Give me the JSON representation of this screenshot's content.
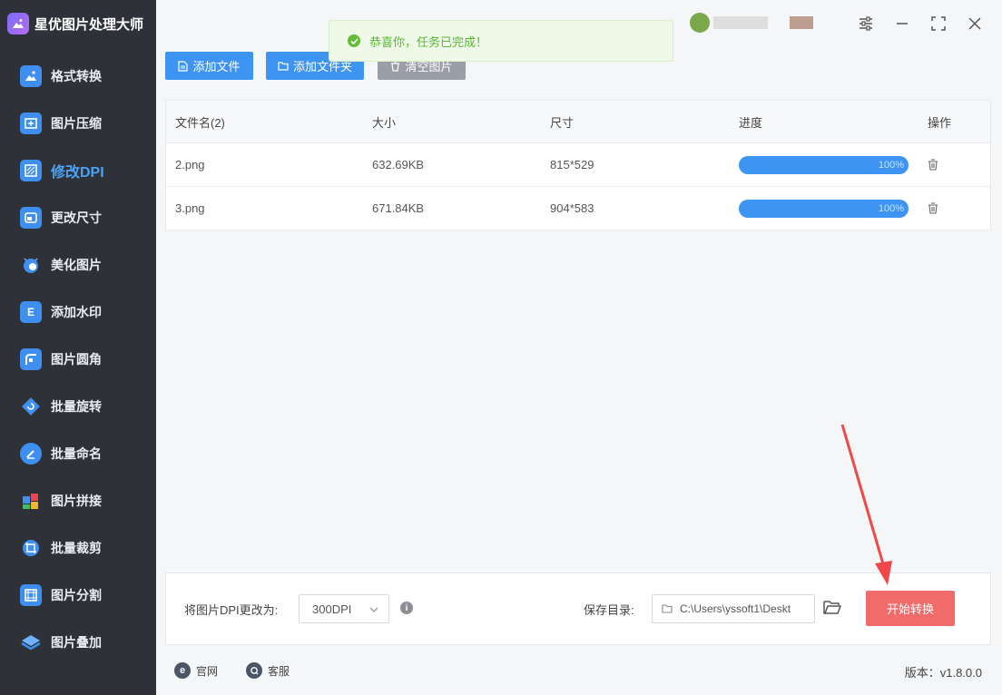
{
  "app": {
    "title": "星优图片处理大师"
  },
  "sidebar": {
    "items": [
      {
        "label": "格式转换",
        "icon": "image-convert-icon"
      },
      {
        "label": "图片压缩",
        "icon": "compress-icon"
      },
      {
        "label": "修改DPI",
        "icon": "dpi-icon",
        "active": true
      },
      {
        "label": "更改尺寸",
        "icon": "resize-icon"
      },
      {
        "label": "美化图片",
        "icon": "beautify-icon"
      },
      {
        "label": "添加水印",
        "icon": "watermark-icon"
      },
      {
        "label": "图片圆角",
        "icon": "round-corner-icon"
      },
      {
        "label": "批量旋转",
        "icon": "rotate-icon"
      },
      {
        "label": "批量命名",
        "icon": "rename-icon"
      },
      {
        "label": "图片拼接",
        "icon": "puzzle-icon"
      },
      {
        "label": "批量裁剪",
        "icon": "crop-icon"
      },
      {
        "label": "图片分割",
        "icon": "split-icon"
      },
      {
        "label": "图片叠加",
        "icon": "layers-icon"
      }
    ]
  },
  "toolbar": {
    "add_file": "添加文件",
    "add_folder": "添加文件夹",
    "clear": "清空图片"
  },
  "toast": {
    "message": "恭喜你，任务已完成！"
  },
  "table": {
    "headers": [
      "文件名(2)",
      "大小",
      "尺寸",
      "进度",
      "操作"
    ],
    "rows": [
      {
        "name": "2.png",
        "size": "632.69KB",
        "dims": "815*529",
        "progress": "100%"
      },
      {
        "name": "3.png",
        "size": "671.84KB",
        "dims": "904*583",
        "progress": "100%"
      }
    ]
  },
  "settings": {
    "dpi_label": "将图片DPI更改为:",
    "dpi_value": "300DPI",
    "save_label": "保存目录:",
    "save_path": "C:\\Users\\yssoft1\\Deskt",
    "start": "开始转换"
  },
  "footer": {
    "website": "官网",
    "service": "客服",
    "version": "版本：v1.8.0.0"
  },
  "colors": {
    "accent": "#3e94f2",
    "danger": "#f26b6b",
    "sidebar": "#2e3138",
    "success": "#5bb536"
  }
}
